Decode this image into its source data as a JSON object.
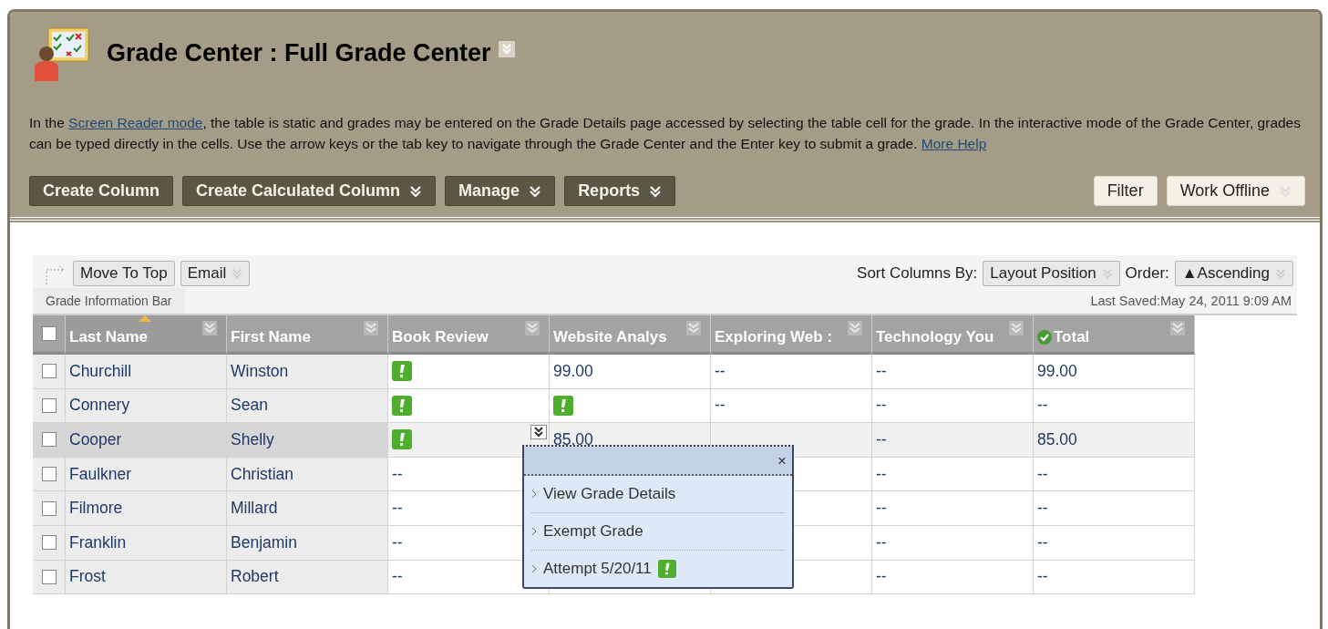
{
  "header": {
    "title": "Grade Center : Full Grade Center",
    "intro": [
      {
        "text": "In the ",
        "link": false
      },
      {
        "text": "Screen Reader mode",
        "link": true
      },
      {
        "text": ", the table is static and grades may be entered on the Grade Details page accessed by selecting the table cell for the grade. In the interactive mode of the Grade Center, grades can be typed directly in the cells. Use the arrow keys or the tab key to navigate through the Grade Center and the Enter key to submit a grade. ",
        "link": false
      },
      {
        "text": "More Help",
        "link": true
      }
    ]
  },
  "action_bar": [
    {
      "label": "Create Column",
      "menu": false
    },
    {
      "label": "Create Calculated Column",
      "menu": true
    },
    {
      "label": "Manage",
      "menu": true
    },
    {
      "label": "Reports",
      "menu": true
    }
  ],
  "right_buttons": [
    {
      "label": "Filter",
      "menu": false
    },
    {
      "label": "Work Offline",
      "menu": true
    }
  ],
  "toolbar": {
    "buttons": [
      {
        "label": "Move To Top",
        "menu": false
      },
      {
        "label": "Email",
        "menu": true
      }
    ],
    "sort_label": "Sort Columns By:",
    "sort_value": "Layout Position",
    "order_label": "Order:",
    "order_value": "▲Ascending",
    "info_bar": "Grade Information Bar",
    "last_saved": "Last Saved:May 24, 2011 9:09 AM"
  },
  "select_all": {
    "checked": false
  },
  "columns": [
    {
      "label": "Last Name",
      "sorted": true,
      "kind": "text"
    },
    {
      "label": "First Name",
      "sorted": false,
      "kind": "text"
    },
    {
      "label": "Book Review",
      "sorted": false,
      "kind": "text"
    },
    {
      "label": "Website Analys",
      "sorted": false,
      "kind": "text"
    },
    {
      "label": "Exploring Web :",
      "sorted": false,
      "kind": "text"
    },
    {
      "label": "Technology You",
      "sorted": false,
      "kind": "text"
    },
    {
      "label": "Total",
      "sorted": false,
      "kind": "total"
    }
  ],
  "rows": [
    {
      "last": "Churchill",
      "first": "Winston",
      "checked": false,
      "selected": false,
      "cells": [
        {
          "kind": "flag"
        },
        {
          "kind": "text",
          "value": "99.00"
        },
        {
          "kind": "text",
          "value": "--"
        },
        {
          "kind": "text",
          "value": "--"
        },
        {
          "kind": "text",
          "value": "99.00"
        }
      ]
    },
    {
      "last": "Connery",
      "first": "Sean",
      "checked": false,
      "selected": false,
      "cells": [
        {
          "kind": "flag"
        },
        {
          "kind": "flag"
        },
        {
          "kind": "text",
          "value": "--"
        },
        {
          "kind": "text",
          "value": "--"
        },
        {
          "kind": "text",
          "value": "--"
        }
      ]
    },
    {
      "last": "Cooper",
      "first": "Shelly",
      "checked": false,
      "selected": true,
      "cells": [
        {
          "kind": "flag",
          "menu": true
        },
        {
          "kind": "text",
          "value": "85.00"
        },
        {
          "kind": "covered"
        },
        {
          "kind": "text",
          "value": "--"
        },
        {
          "kind": "text",
          "value": "85.00"
        }
      ]
    },
    {
      "last": "Faulkner",
      "first": "Christian",
      "checked": false,
      "selected": false,
      "cells": [
        {
          "kind": "text",
          "value": "--"
        },
        {
          "kind": "hidden"
        },
        {
          "kind": "covered"
        },
        {
          "kind": "text",
          "value": "--"
        },
        {
          "kind": "text",
          "value": "--"
        }
      ]
    },
    {
      "last": "Filmore",
      "first": "Millard",
      "checked": false,
      "selected": false,
      "cells": [
        {
          "kind": "text",
          "value": "--"
        },
        {
          "kind": "hidden"
        },
        {
          "kind": "covered"
        },
        {
          "kind": "text",
          "value": "--"
        },
        {
          "kind": "text",
          "value": "--"
        }
      ]
    },
    {
      "last": "Franklin",
      "first": "Benjamin",
      "checked": false,
      "selected": false,
      "cells": [
        {
          "kind": "text",
          "value": "--"
        },
        {
          "kind": "hidden"
        },
        {
          "kind": "covered"
        },
        {
          "kind": "text",
          "value": "--"
        },
        {
          "kind": "text",
          "value": "--"
        }
      ]
    },
    {
      "last": "Frost",
      "first": "Robert",
      "checked": false,
      "selected": false,
      "cells": [
        {
          "kind": "text",
          "value": "--"
        },
        {
          "kind": "hidden"
        },
        {
          "kind": "covered"
        },
        {
          "kind": "text",
          "value": "--"
        },
        {
          "kind": "text",
          "value": "--"
        }
      ]
    }
  ],
  "popup": {
    "close": "×",
    "items": [
      {
        "label": "View Grade Details",
        "flag": false
      },
      {
        "label": "Exempt Grade",
        "flag": false
      },
      {
        "label": "Attempt 5/20/11",
        "flag": true
      }
    ]
  }
}
